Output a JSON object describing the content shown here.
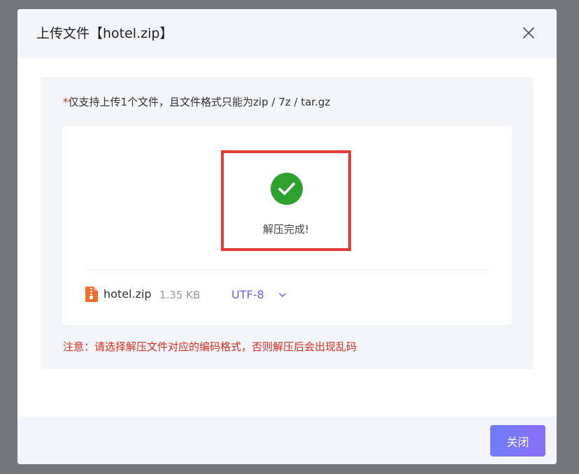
{
  "dialog": {
    "title": "上传文件【hotel.zip】"
  },
  "upload": {
    "required_mark": "*",
    "support_hint": "仅支持上传1个文件，且文件格式只能为zip / 7z / tar.gz",
    "status_text": "解压完成!",
    "status_icon": "check-circle-icon",
    "status_color": "#2ea12e",
    "highlight_color": "#e53935"
  },
  "file": {
    "icon": "zip-file-icon",
    "name": "hotel.zip",
    "size": "1.35 KB",
    "encoding": "UTF-8"
  },
  "warning": {
    "text": "注意：请选择解压文件对应的编码格式，否则解压后会出现乱码",
    "color": "#d92d20"
  },
  "footer": {
    "close_label": "关闭",
    "accent": "#7b74f8"
  }
}
